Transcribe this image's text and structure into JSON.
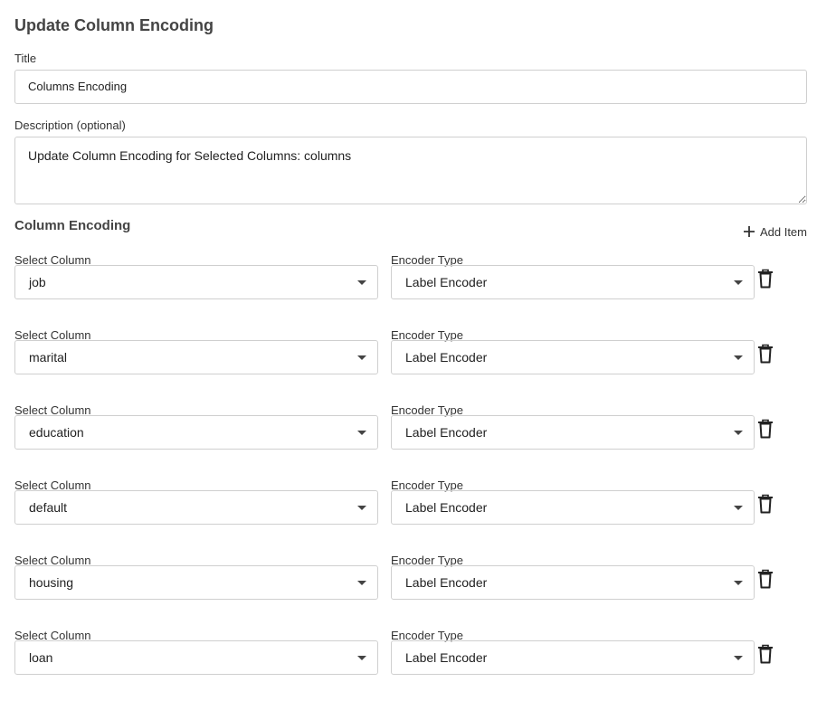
{
  "page": {
    "title": "Update Column Encoding"
  },
  "form": {
    "title_label": "Title",
    "title_value": "Columns Encoding",
    "description_label": "Description (optional)",
    "description_value": "Update Column Encoding for Selected Columns: columns",
    "section_title": "Column Encoding",
    "add_item_label": "Add Item",
    "column_label": "Select Column",
    "encoder_label": "Encoder Type",
    "rows": [
      {
        "column": "job",
        "encoder": "Label Encoder"
      },
      {
        "column": "marital",
        "encoder": "Label Encoder"
      },
      {
        "column": "education",
        "encoder": "Label Encoder"
      },
      {
        "column": "default",
        "encoder": "Label Encoder"
      },
      {
        "column": "housing",
        "encoder": "Label Encoder"
      },
      {
        "column": "loan",
        "encoder": "Label Encoder"
      }
    ]
  },
  "icons": {
    "add": "plus-icon",
    "remove": "trash-icon",
    "dropdown": "chevron-down-icon"
  }
}
